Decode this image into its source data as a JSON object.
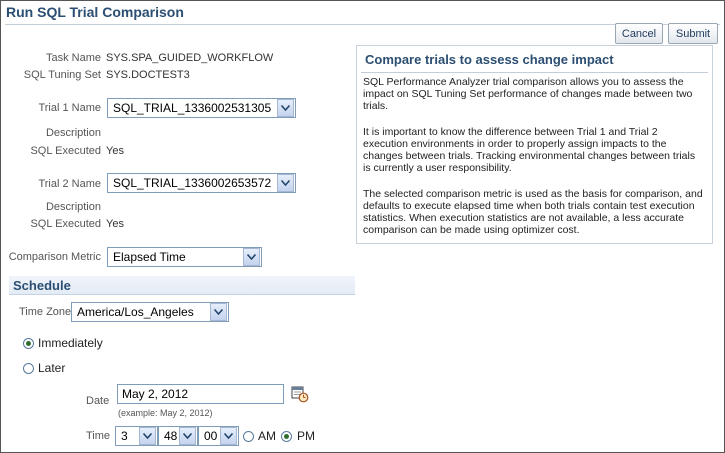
{
  "page": {
    "title": "Run SQL Trial Comparison"
  },
  "buttons": {
    "cancel": "Cancel",
    "submit": "Submit"
  },
  "fields": {
    "task_name_label": "Task Name",
    "task_name_value": "SYS.SPA_GUIDED_WORKFLOW",
    "sts_label": "SQL Tuning Set",
    "sts_value": "SYS.DOCTEST3",
    "trial1_label": "Trial 1 Name",
    "trial1_value": "SQL_TRIAL_1336002531305",
    "trial1_desc_label": "Description",
    "trial1_exec_label": "SQL Executed",
    "trial1_exec_value": "Yes",
    "trial2_label": "Trial 2 Name",
    "trial2_value": "SQL_TRIAL_1336002653572",
    "trial2_desc_label": "Description",
    "trial2_exec_label": "SQL Executed",
    "trial2_exec_value": "Yes",
    "metric_label": "Comparison Metric",
    "metric_value": "Elapsed Time"
  },
  "help": {
    "title": "Compare trials to assess change impact",
    "p1": "SQL Performance Analyzer trial comparison allows you to assess the impact on SQL Tuning Set performance of changes made between two trials.",
    "p2": "It is important to know the difference between Trial 1 and Trial 2 execution environments in order to properly assign impacts to the changes between trials. Tracking environmental changes between trials is currently a user responsibility.",
    "p3": "The selected comparison metric is used as the basis for comparison, and defaults to execute elapsed time when both trials contain test execution statistics. When execution statistics are not available, a less accurate comparison can be made using optimizer cost."
  },
  "schedule": {
    "heading": "Schedule",
    "timezone_label": "Time Zone",
    "timezone_value": "America/Los_Angeles",
    "immediately_label": "Immediately",
    "later_label": "Later",
    "selected": "immediately",
    "date_label": "Date",
    "date_value": "May 2, 2012",
    "date_hint": "(example: May 2, 2012)",
    "time_label": "Time",
    "hour": "3",
    "minute": "48",
    "second": "00",
    "am_label": "AM",
    "pm_label": "PM",
    "meridiem": "PM"
  },
  "icons": {
    "calendar": "calendar-icon",
    "dropdown": "chevron-down-icon"
  },
  "colors": {
    "title": "#2b4e72",
    "radio_selected": "#2e6d2e"
  }
}
